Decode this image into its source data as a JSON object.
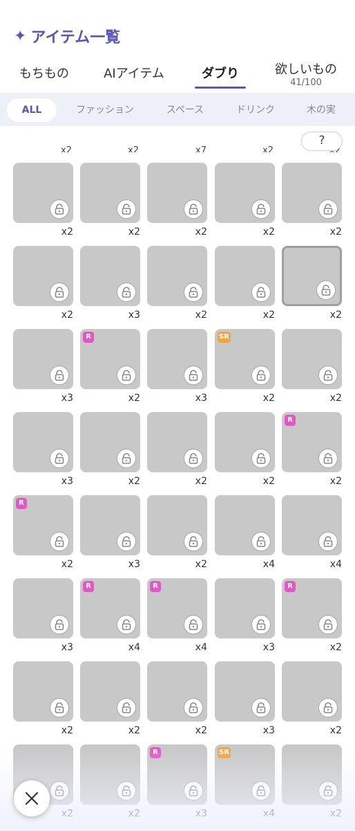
{
  "header": {
    "title": "アイテム一覧",
    "title_icon": "sparkle-icon"
  },
  "tabs": [
    {
      "label": "もちもの"
    },
    {
      "label": "AIアイテム"
    },
    {
      "label": "ダブり"
    },
    {
      "label": "欲しいもの",
      "count": "41/100"
    }
  ],
  "filters": [
    "ALL",
    "ファッション",
    "スペース",
    "ドリンク",
    "木の実"
  ],
  "help_label": "?",
  "top_counts": [
    "x2",
    "x2",
    "x7",
    "x2",
    "x2"
  ],
  "items": [
    {
      "qty": "x2",
      "badge": ""
    },
    {
      "qty": "x2",
      "badge": ""
    },
    {
      "qty": "x2",
      "badge": ""
    },
    {
      "qty": "x2",
      "badge": ""
    },
    {
      "qty": "x2",
      "badge": ""
    },
    {
      "qty": "x2",
      "badge": ""
    },
    {
      "qty": "x3",
      "badge": ""
    },
    {
      "qty": "x2",
      "badge": ""
    },
    {
      "qty": "x2",
      "badge": ""
    },
    {
      "qty": "x2",
      "badge": ""
    },
    {
      "qty": "x3",
      "badge": ""
    },
    {
      "qty": "x2",
      "badge": "R"
    },
    {
      "qty": "x3",
      "badge": ""
    },
    {
      "qty": "x2",
      "badge": "SR"
    },
    {
      "qty": "x2",
      "badge": ""
    },
    {
      "qty": "x3",
      "badge": ""
    },
    {
      "qty": "x2",
      "badge": ""
    },
    {
      "qty": "x2",
      "badge": ""
    },
    {
      "qty": "x2",
      "badge": ""
    },
    {
      "qty": "x2",
      "badge": "R"
    },
    {
      "qty": "x2",
      "badge": "R"
    },
    {
      "qty": "x3",
      "badge": ""
    },
    {
      "qty": "x2",
      "badge": ""
    },
    {
      "qty": "x4",
      "badge": ""
    },
    {
      "qty": "x4",
      "badge": ""
    },
    {
      "qty": "x3",
      "badge": ""
    },
    {
      "qty": "x4",
      "badge": "R"
    },
    {
      "qty": "x4",
      "badge": "R"
    },
    {
      "qty": "x3",
      "badge": ""
    },
    {
      "qty": "x2",
      "badge": "R"
    },
    {
      "qty": "x2",
      "badge": ""
    },
    {
      "qty": "x2",
      "badge": ""
    },
    {
      "qty": "x2",
      "badge": ""
    },
    {
      "qty": "x3",
      "badge": ""
    },
    {
      "qty": "x2",
      "badge": ""
    },
    {
      "qty": "x2",
      "badge": ""
    },
    {
      "qty": "x2",
      "badge": ""
    },
    {
      "qty": "x3",
      "badge": "R"
    },
    {
      "qty": "x4",
      "badge": "SR"
    },
    {
      "qty": "x2",
      "badge": ""
    }
  ],
  "close_icon": "close-icon",
  "colors": {
    "accent": "#5a55b8",
    "tile": "#c8c8c8",
    "badge_r": "#e456c8",
    "badge_sr": "#f4a43c"
  }
}
